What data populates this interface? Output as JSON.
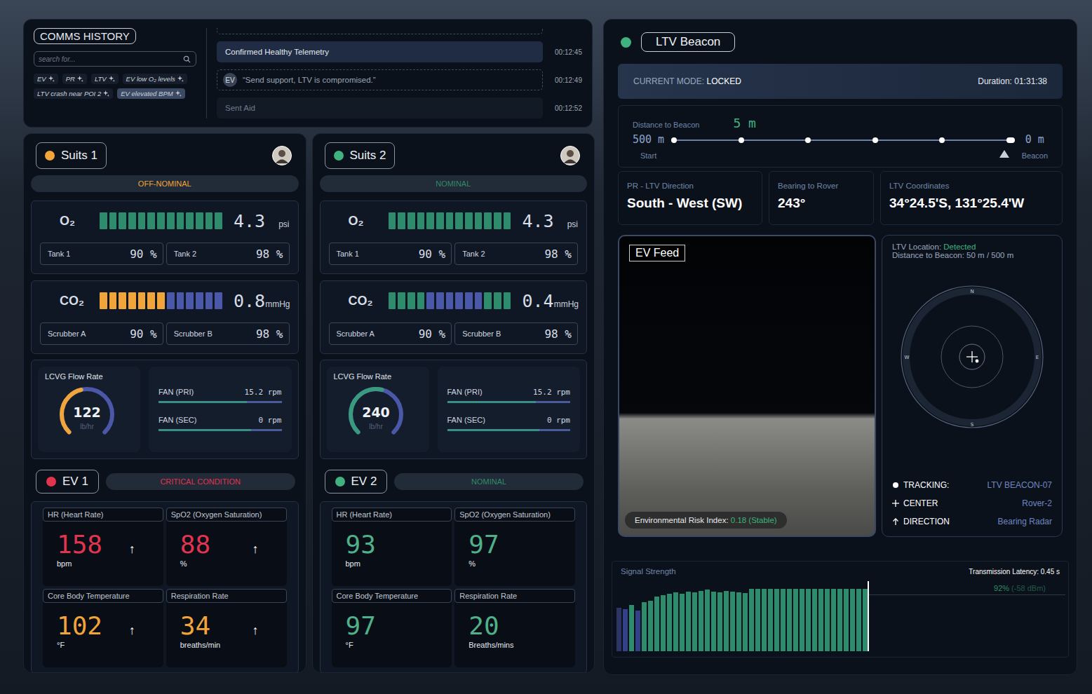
{
  "comms": {
    "title": "COMMS HISTORY",
    "search": {
      "placeholder": "search for..."
    },
    "tags": [
      {
        "label": "EV",
        "selected": false
      },
      {
        "label": "PR",
        "selected": false
      },
      {
        "label": "LTV",
        "selected": false
      },
      {
        "label": "EV low O₂ levels",
        "selected": false
      },
      {
        "label": "LTV crash near POI 2",
        "selected": false
      },
      {
        "label": "EV elevated BPM",
        "selected": true
      }
    ],
    "messages": [
      {
        "kind": "status",
        "text": "Confirmed Healthy Telemetry",
        "time": "00:12:45",
        "selected": true
      },
      {
        "kind": "quote",
        "sender": "EV",
        "text": "“Send support, LTV is compromised.”",
        "time": "00:12:49",
        "selected": false
      },
      {
        "kind": "status",
        "text": "Sent Aid",
        "time": "00:12:52",
        "selected": false
      }
    ]
  },
  "suits": [
    {
      "name": "Suits 1",
      "color": "#f0a43a",
      "status": "OFF-NOMINAL",
      "status_color": "#f0a43a",
      "gases": [
        {
          "label": "O₂",
          "value": "4.3",
          "unit": "psi",
          "segments": [
            "#2e8c6c",
            "#2e8c6c",
            "#2e8c6c",
            "#2e8c6c",
            "#2e8c6c",
            "#2e8c6c",
            "#2e8c6c",
            "#2e8c6c",
            "#2e8c6c",
            "#2e8c6c",
            "#2e8c6c",
            "#2e8c6c",
            "#2e8c6c"
          ],
          "parts": [
            {
              "label": "Tank 1",
              "value": "90 %"
            },
            {
              "label": "Tank 2",
              "value": "98 %"
            }
          ]
        },
        {
          "label": "CO₂",
          "value": "0.8",
          "unit": "mmHg",
          "segments": [
            "#f0a43a",
            "#f0a43a",
            "#f0a43a",
            "#f0a43a",
            "#f0a43a",
            "#f0a43a",
            "#f0a43a",
            "#4b57a8",
            "#4b57a8",
            "#4b57a8",
            "#4b57a8",
            "#4b57a8",
            "#4b57a8"
          ],
          "parts": [
            {
              "label": "Scrubber A",
              "value": "90 %"
            },
            {
              "label": "Scrubber B",
              "value": "98 %"
            }
          ]
        }
      ],
      "lcvg": {
        "label": "LCVG Flow Rate",
        "value": "122",
        "unit": "lb/hr",
        "level": 0.45,
        "color": "#f0a43a"
      },
      "fans": [
        {
          "label": "FAN (PRI)",
          "reading": "15.2 rpm",
          "level": 0.72
        },
        {
          "label": "FAN (SEC)",
          "reading": "0 rpm",
          "level": 0.75
        }
      ],
      "ev": {
        "name": "EV 1",
        "color": "#e0344f",
        "status": "CRITICAL CONDITION",
        "status_color": "#e0344f",
        "vitals": [
          {
            "label": "HR (Heart Rate)",
            "value": "158",
            "unit": "bpm",
            "color": "#e0344f",
            "trend": "↑"
          },
          {
            "label": "SpO2 (Oxygen Saturation)",
            "value": "88",
            "unit": "%",
            "color": "#e0344f",
            "trend": "↑"
          },
          {
            "label": "Core Body Temperature",
            "value": "102",
            "unit": "°F",
            "color": "#f0a43a",
            "trend": "↑"
          },
          {
            "label": "Respiration Rate",
            "value": "34",
            "unit": "breaths/min",
            "color": "#f0a43a",
            "trend": "↑"
          }
        ]
      }
    },
    {
      "name": "Suits 2",
      "color": "#3fb27f",
      "status": "NOMINAL",
      "status_color": "#2f8a68",
      "gases": [
        {
          "label": "O₂",
          "value": "4.3",
          "unit": "psi",
          "segments": [
            "#2e8c6c",
            "#2e8c6c",
            "#2e8c6c",
            "#2e8c6c",
            "#2e8c6c",
            "#2e8c6c",
            "#2e8c6c",
            "#2e8c6c",
            "#2e8c6c",
            "#2e8c6c",
            "#2e8c6c",
            "#2e8c6c",
            "#2e8c6c"
          ],
          "parts": [
            {
              "label": "Tank 1",
              "value": "90 %"
            },
            {
              "label": "Tank 2",
              "value": "98 %"
            }
          ]
        },
        {
          "label": "CO₂",
          "value": "0.4",
          "unit": "mmHg",
          "segments": [
            "#2e8c6c",
            "#2e8c6c",
            "#2e8c6c",
            "#2e8c6c",
            "#4b57a8",
            "#4b57a8",
            "#4b57a8",
            "#4b57a8",
            "#4b57a8",
            "#4b57a8",
            "#2e8c6c",
            "#2e8c6c",
            "#2e8c6c"
          ],
          "parts": [
            {
              "label": "Scrubber A",
              "value": "90 %"
            },
            {
              "label": "Scrubber B",
              "value": "98 %"
            }
          ]
        }
      ],
      "lcvg": {
        "label": "LCVG Flow Rate",
        "value": "240",
        "unit": "lb/hr",
        "level": 0.55,
        "color": "#3a9a80"
      },
      "fans": [
        {
          "label": "FAN (PRI)",
          "reading": "15.2 rpm",
          "level": 0.72
        },
        {
          "label": "FAN (SEC)",
          "reading": "0 rpm",
          "level": 0.75
        }
      ],
      "ev": {
        "name": "EV 2",
        "color": "#3fb27f",
        "status": "NOMINAL",
        "status_color": "#2f8a68",
        "vitals": [
          {
            "label": "HR (Heart Rate)",
            "value": "93",
            "unit": "bpm",
            "color": "#4fb08a"
          },
          {
            "label": "SpO2 (Oxygen Saturation)",
            "value": "97",
            "unit": "%",
            "color": "#4fb08a"
          },
          {
            "label": "Core Body Temperature",
            "value": "97",
            "unit": "°F",
            "color": "#4fb08a"
          },
          {
            "label": "Respiration Rate",
            "value": "20",
            "unit": "Breaths/mins",
            "color": "#4fb08a"
          }
        ]
      }
    }
  ],
  "beacon": {
    "title": "LTV Beacon",
    "color": "#3fb27f",
    "mode_label": "CURRENT MODE:",
    "mode": "LOCKED",
    "duration": "Duration: 01:31:38",
    "distance": {
      "label": "Distance to Beacon",
      "value": "5 m",
      "start": "500 m",
      "start_caption": "Start",
      "end": "0 m",
      "end_caption": "Beacon",
      "level": 0.97,
      "stops": 6
    },
    "cards": [
      {
        "label": "PR - LTV Direction",
        "value": "South - West (SW)"
      },
      {
        "label": "Bearing to Rover",
        "value": "243°"
      },
      {
        "label": "LTV Coordinates",
        "value": "34°24.5'S, 131°25.4'W"
      }
    ]
  },
  "feed": {
    "title": "EV Feed",
    "risk_label": "Environmental Risk Index:",
    "risk_value": "0.18 (Stable)"
  },
  "radar": {
    "location_label": "LTV Location:",
    "location_value": "Detected",
    "distance": "Distance to Beacon: 50 m / 500 m",
    "compass": {
      "n": "N",
      "e": "E",
      "s": "S",
      "w": "W"
    },
    "legend": [
      {
        "kind": "dot",
        "label": "TRACKING:",
        "value": "LTV BEACON-07"
      },
      {
        "kind": "cross",
        "label": "CENTER",
        "value": "Rover-2"
      },
      {
        "kind": "arrow",
        "label": "DIRECTION",
        "value": "Bearing Radar"
      }
    ]
  },
  "signal": {
    "title": "Signal Strength",
    "latency": "Transmission Latency: 0.45 s",
    "reading": "92%",
    "dbm": "(-58 dBm)",
    "bars": [
      {
        "value": 62,
        "color": "#2b3566"
      },
      {
        "value": 60,
        "color": "#33418a"
      },
      {
        "value": 66,
        "color": "#2e8c6c"
      },
      {
        "value": 58,
        "color": "#33418a"
      },
      {
        "value": 70,
        "color": "#2e8c6c"
      },
      {
        "value": 72,
        "color": "#2e8c6c"
      },
      {
        "value": 78,
        "color": "#2e8c6c"
      },
      {
        "value": 80,
        "color": "#2e8c6c"
      },
      {
        "value": 82,
        "color": "#2e8c6c"
      },
      {
        "value": 84,
        "color": "#2e8c6c"
      },
      {
        "value": 82,
        "color": "#2e8c6c"
      },
      {
        "value": 85,
        "color": "#2e8c6c"
      },
      {
        "value": 84,
        "color": "#2e8c6c"
      },
      {
        "value": 86,
        "color": "#2e8c6c"
      },
      {
        "value": 88,
        "color": "#2e8c6c"
      },
      {
        "value": 85,
        "color": "#2e8c6c"
      },
      {
        "value": 84,
        "color": "#2e8c6c"
      },
      {
        "value": 86,
        "color": "#2e8c6c"
      },
      {
        "value": 85,
        "color": "#2e8c6c"
      },
      {
        "value": 84,
        "color": "#2e8c6c"
      },
      {
        "value": 83,
        "color": "#2e8c6c"
      },
      {
        "value": 89,
        "color": "#2e8c6c"
      },
      {
        "value": 89,
        "color": "#2e8c6c"
      },
      {
        "value": 89,
        "color": "#2e8c6c"
      },
      {
        "value": 89,
        "color": "#2e8c6c"
      },
      {
        "value": 89,
        "color": "#2e8c6c"
      },
      {
        "value": 89,
        "color": "#2e8c6c"
      },
      {
        "value": 89,
        "color": "#2e8c6c"
      },
      {
        "value": 89,
        "color": "#2e8c6c"
      },
      {
        "value": 89,
        "color": "#2e8c6c"
      },
      {
        "value": 89,
        "color": "#2e8c6c"
      },
      {
        "value": 89,
        "color": "#2e8c6c"
      },
      {
        "value": 89,
        "color": "#2e8c6c"
      },
      {
        "value": 89,
        "color": "#2e8c6c"
      },
      {
        "value": 89,
        "color": "#2e8c6c"
      },
      {
        "value": 89,
        "color": "#2e8c6c"
      },
      {
        "value": 89,
        "color": "#2e8c6c"
      },
      {
        "value": 89,
        "color": "#2e8c6c"
      },
      {
        "value": 89,
        "color": "#2e8c6c"
      },
      {
        "value": 89,
        "color": "#2e8c6c"
      }
    ]
  }
}
